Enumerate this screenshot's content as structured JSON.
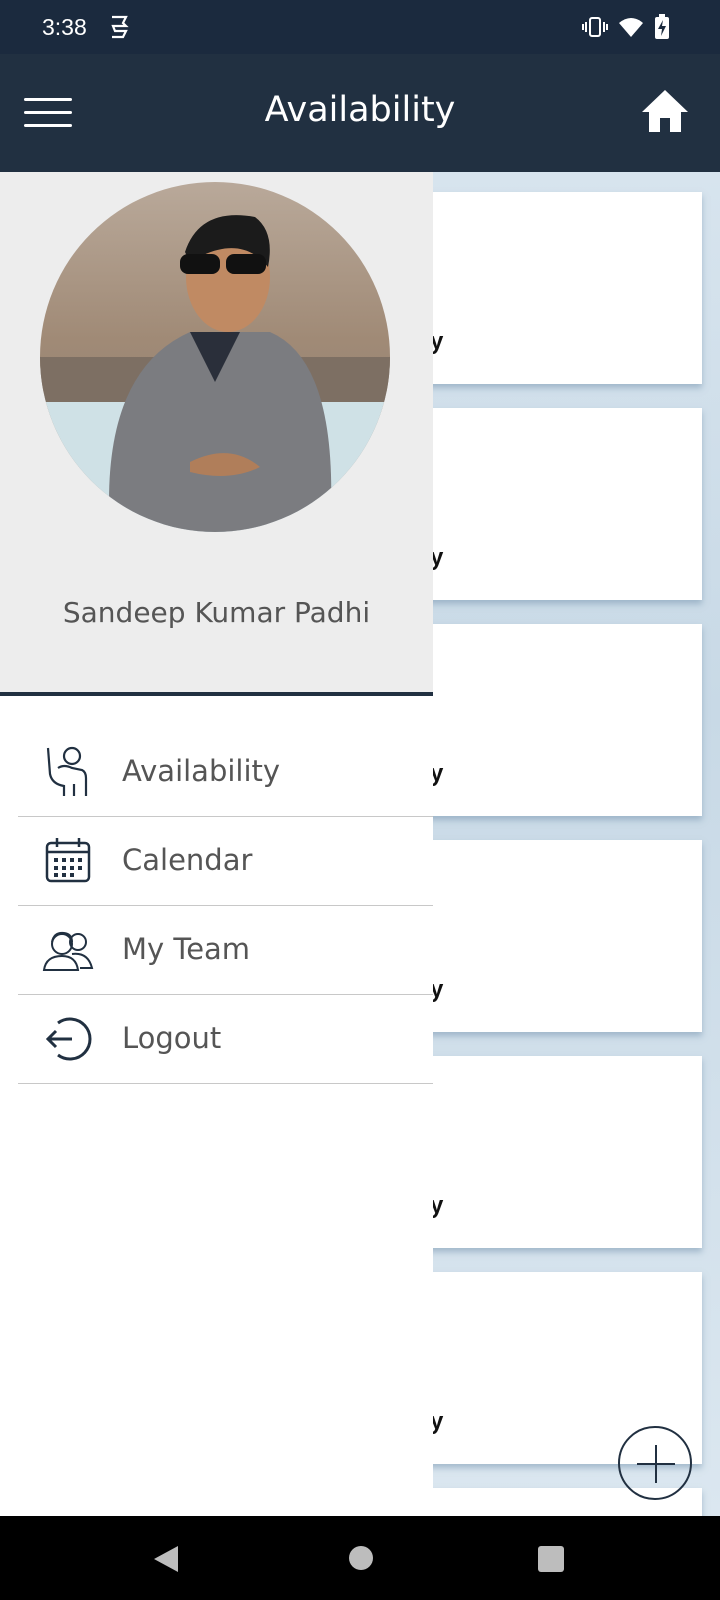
{
  "status_bar": {
    "time": "3:38",
    "icons": [
      "notification-icon",
      "vibrate-icon",
      "wifi-icon",
      "battery-charging-icon"
    ]
  },
  "app_bar": {
    "title": "Availability",
    "menu_icon": "hamburger-menu-icon",
    "home_icon": "home-icon"
  },
  "drawer": {
    "profile": {
      "name": "Sandeep Kumar Padhi",
      "avatar": "profile-photo"
    },
    "items": [
      {
        "label": "Availability",
        "icon": "raised-hand-person-icon"
      },
      {
        "label": "Calendar",
        "icon": "calendar-icon"
      },
      {
        "label": "My Team",
        "icon": "team-icon"
      },
      {
        "label": "Logout",
        "icon": "logout-icon"
      }
    ]
  },
  "background_cards": [
    {
      "visible_text": "y"
    },
    {
      "visible_text": "y"
    },
    {
      "visible_text": "y"
    },
    {
      "visible_text": "y"
    },
    {
      "visible_text": "y"
    },
    {
      "visible_text": "y"
    }
  ],
  "colors": {
    "primary": "#213041",
    "drawer_header_bg": "#ededed",
    "content_bg": "#d7e4ee"
  }
}
